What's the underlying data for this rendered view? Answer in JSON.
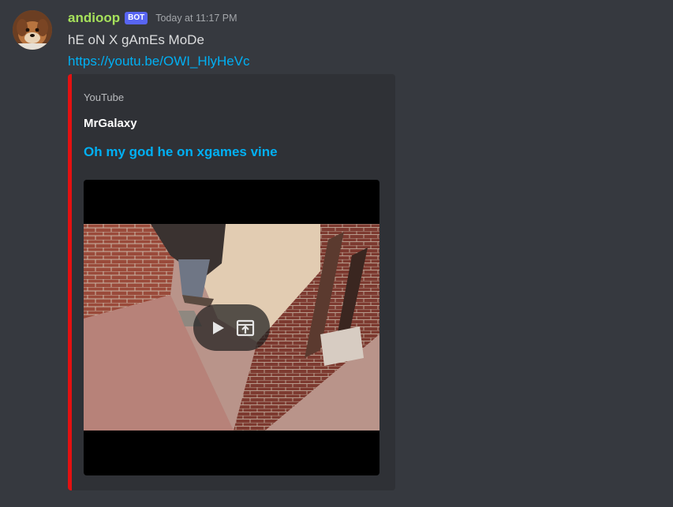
{
  "message": {
    "username": "andioop",
    "bot_tag": "BOT",
    "timestamp": "Today at 11:17 PM",
    "content": "hE oN X gAmEs MoDe",
    "link": "https://youtu.be/OWI_HlyHeVc"
  },
  "embed": {
    "provider": "YouTube",
    "author": "MrGalaxy",
    "title": "Oh my god he on xgames vine",
    "color": "#e31111",
    "controls": {
      "play_icon": "play-icon",
      "open_icon": "open-external-icon"
    }
  },
  "colors": {
    "background": "#36393f",
    "username": "#a6e15b",
    "link": "#00b0f4",
    "bot_tag": "#5865f2",
    "embed_bg": "#2f3136"
  }
}
